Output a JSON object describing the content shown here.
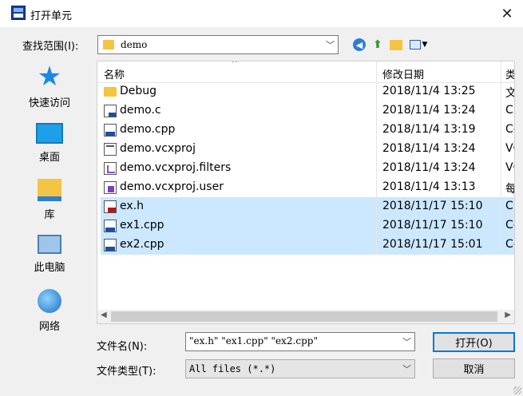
{
  "window": {
    "title": "打开单元",
    "close_glyph": "✕"
  },
  "lookin": {
    "label": "查找范围(I):",
    "value": "demo"
  },
  "places": [
    {
      "label": "快速访问"
    },
    {
      "label": "桌面"
    },
    {
      "label": "库"
    },
    {
      "label": "此电脑"
    },
    {
      "label": "网络"
    }
  ],
  "columns": {
    "name": "名称",
    "date": "修改日期",
    "type": "类"
  },
  "files": [
    {
      "name": "Debug",
      "date": "2018/11/4 13:25",
      "type": "文",
      "icon": "folder-icon",
      "selected": false
    },
    {
      "name": "demo.c",
      "date": "2018/11/4 13:24",
      "type": "C",
      "icon": "c-file-icon",
      "selected": false
    },
    {
      "name": "demo.cpp",
      "date": "2018/11/4 13:19",
      "type": "C-",
      "icon": "cpp-file-icon",
      "selected": false
    },
    {
      "name": "demo.vcxproj",
      "date": "2018/11/4 13:24",
      "type": "VC",
      "icon": "vcxproj-file-icon",
      "selected": false
    },
    {
      "name": "demo.vcxproj.filters",
      "date": "2018/11/4 13:24",
      "type": "VC",
      "icon": "filters-file-icon",
      "selected": false
    },
    {
      "name": "demo.vcxproj.user",
      "date": "2018/11/4 13:13",
      "type": "每",
      "icon": "user-file-icon",
      "selected": false
    },
    {
      "name": "ex.h",
      "date": "2018/11/17 15:10",
      "type": "C",
      "icon": "h-file-icon",
      "selected": true
    },
    {
      "name": "ex1.cpp",
      "date": "2018/11/17 15:10",
      "type": "C-",
      "icon": "cpp-file-icon",
      "selected": true
    },
    {
      "name": "ex2.cpp",
      "date": "2018/11/17 15:01",
      "type": "C-",
      "icon": "cpp-file-icon",
      "selected": true
    }
  ],
  "filename": {
    "label": "文件名(N):",
    "value": "\"ex.h\" \"ex1.cpp\" \"ex2.cpp\""
  },
  "filetype": {
    "label": "文件类型(T):",
    "value": "All files (*.*)"
  },
  "buttons": {
    "open": "打开(O)",
    "cancel": "取消"
  }
}
